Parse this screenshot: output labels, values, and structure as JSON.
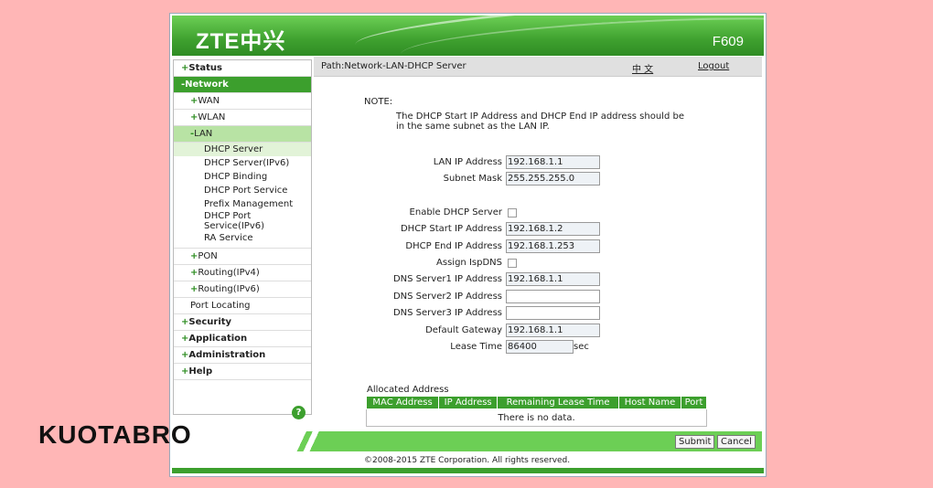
{
  "header": {
    "logo": "ZTE中兴",
    "model": "F609"
  },
  "sidebar": {
    "items": [
      {
        "label": "Status",
        "sign": "+"
      },
      {
        "label": "Network",
        "sign": "-"
      },
      {
        "label": "WAN",
        "sign": "+"
      },
      {
        "label": "WLAN",
        "sign": "+"
      },
      {
        "label": "LAN",
        "sign": "-"
      },
      {
        "label": "PON",
        "sign": "+"
      },
      {
        "label": "Routing(IPv4)",
        "sign": "+"
      },
      {
        "label": "Routing(IPv6)",
        "sign": "+"
      },
      {
        "label": "Port Locating",
        "sign": ""
      },
      {
        "label": "Security",
        "sign": "+"
      },
      {
        "label": "Application",
        "sign": "+"
      },
      {
        "label": "Administration",
        "sign": "+"
      },
      {
        "label": "Help",
        "sign": "+"
      }
    ],
    "lan_subitems": [
      "DHCP Server",
      "DHCP Server(IPv6)",
      "DHCP Binding",
      "DHCP Port Service",
      "Prefix Management",
      "DHCP Port Service(IPv6)",
      "RA Service"
    ],
    "help_icon": "?"
  },
  "pathbar": {
    "path": "Path:Network-LAN-DHCP Server",
    "lang": "中 文",
    "logout": "Logout"
  },
  "note": {
    "label": "NOTE:",
    "text": "The DHCP Start IP Address and DHCP End IP address should be in the same subnet as the LAN IP."
  },
  "form": {
    "lan_ip": {
      "label": "LAN IP Address",
      "value": "192.168.1.1"
    },
    "subnet_mask": {
      "label": "Subnet Mask",
      "value": "255.255.255.0"
    },
    "enable_dhcp": {
      "label": "Enable DHCP Server",
      "checked": false
    },
    "dhcp_start": {
      "label": "DHCP Start IP Address",
      "value": "192.168.1.2"
    },
    "dhcp_end": {
      "label": "DHCP End IP Address",
      "value": "192.168.1.253"
    },
    "assign_isp_dns": {
      "label": "Assign IspDNS",
      "checked": false
    },
    "dns1": {
      "label": "DNS Server1 IP Address",
      "value": "192.168.1.1"
    },
    "dns2": {
      "label": "DNS Server2 IP Address",
      "value": ""
    },
    "dns3": {
      "label": "DNS Server3 IP Address",
      "value": ""
    },
    "gateway": {
      "label": "Default Gateway",
      "value": "192.168.1.1"
    },
    "lease": {
      "label": "Lease Time",
      "value": "86400",
      "unit": "sec"
    }
  },
  "allocated": {
    "title": "Allocated Address",
    "columns": [
      "MAC Address",
      "IP Address",
      "Remaining Lease Time",
      "Host Name",
      "Port"
    ],
    "empty_text": "There is no data."
  },
  "buttons": {
    "submit": "Submit",
    "cancel": "Cancel"
  },
  "footer": {
    "copyright": "©2008-2015 ZTE Corporation. All rights reserved."
  },
  "watermark": {
    "brand": "KUOTABRO"
  },
  "colors": {
    "accent": "#3c9f2d",
    "background": "#ffb6b6"
  }
}
